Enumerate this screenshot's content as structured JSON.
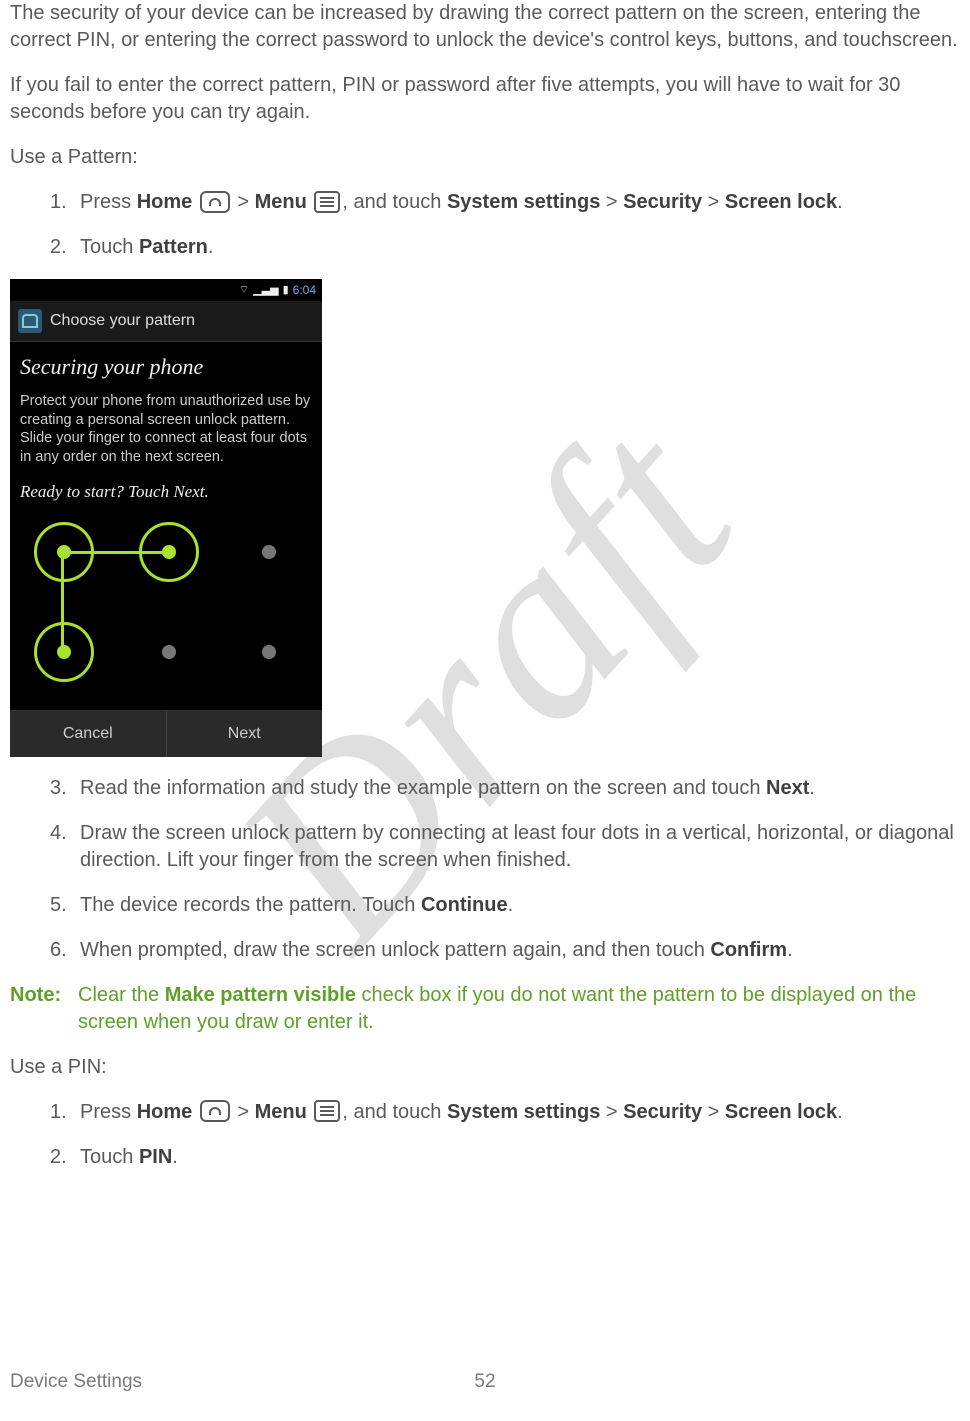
{
  "watermark": "Draft",
  "intro_para_1": "The security of your device can be increased by drawing the correct pattern on the screen, entering the correct PIN, or entering the correct password to unlock the device's control keys, buttons, and touchscreen.",
  "intro_para_2": "If you fail to enter the correct pattern, PIN or password after five attempts, you will have to wait for 30 seconds before you can try again.",
  "use_pattern_heading": "Use a Pattern:",
  "pattern_steps": {
    "s1_a": "Press ",
    "s1_home": "Home",
    "s1_b": " > ",
    "s1_menu": "Menu",
    "s1_c": ", and touch ",
    "s1_ss": "System settings",
    "s1_d": " > ",
    "s1_sec": "Security",
    "s1_e": " > ",
    "s1_sl": "Screen lock",
    "s1_f": ".",
    "s2_a": "Touch ",
    "s2_b": "Pattern",
    "s2_c": ".",
    "s3_a": "Read the information and study the example pattern on the screen and touch ",
    "s3_b": "Next",
    "s3_c": ".",
    "s4": "Draw the screen unlock pattern by connecting at least four dots in a vertical, horizontal, or diagonal direction. Lift your finger from the screen when finished.",
    "s5_a": "The device records the pattern. Touch ",
    "s5_b": "Continue",
    "s5_c": ".",
    "s6_a": "When prompted, draw the screen unlock pattern again, and then touch ",
    "s6_b": "Confirm",
    "s6_c": "."
  },
  "note": {
    "label": "Note:",
    "text_a": "Clear the ",
    "text_bold": "Make pattern visible",
    "text_b": " check box if you do not want the pattern to be displayed on the screen when you draw or enter it."
  },
  "use_pin_heading": "Use a PIN:",
  "pin_steps": {
    "s1_a": "Press ",
    "s1_home": "Home",
    "s1_b": " > ",
    "s1_menu": "Menu",
    "s1_c": ", and touch ",
    "s1_ss": "System settings",
    "s1_d": " > ",
    "s1_sec": "Security",
    "s1_e": " > ",
    "s1_sl": "Screen lock",
    "s1_f": ".",
    "s2_a": "Touch ",
    "s2_b": "PIN",
    "s2_c": "."
  },
  "phone": {
    "time": "6:04",
    "header": "Choose your pattern",
    "title": "Securing your phone",
    "body": "Protect your phone from unauthorized use by creating a personal screen unlock pattern. Slide your finger to connect at least four dots in any order on the next screen.",
    "ready": "Ready to start? Touch Next.",
    "cancel": "Cancel",
    "next": "Next"
  },
  "footer": {
    "section": "Device Settings",
    "page": "52"
  }
}
